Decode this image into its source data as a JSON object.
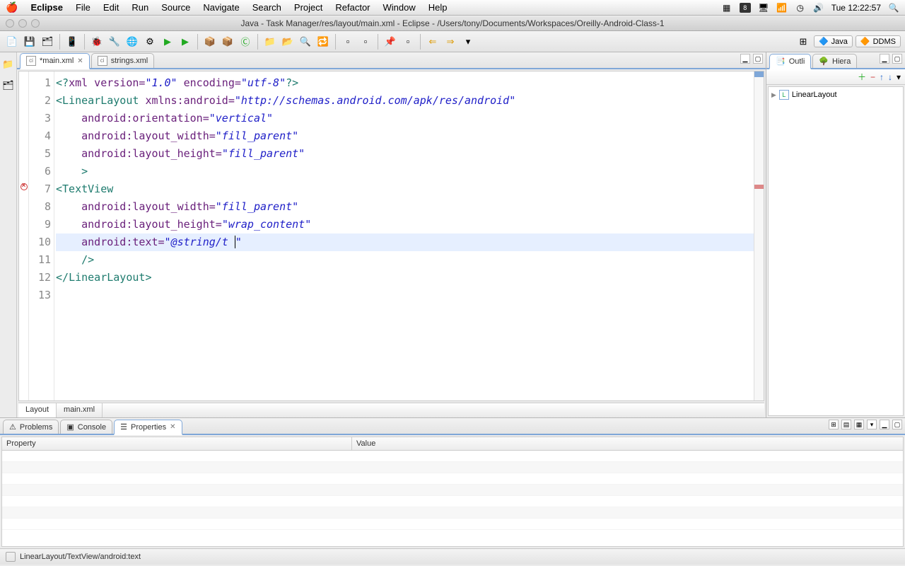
{
  "menubar": {
    "app": "Eclipse",
    "items": [
      "File",
      "Edit",
      "Run",
      "Source",
      "Navigate",
      "Search",
      "Project",
      "Refactor",
      "Window",
      "Help"
    ],
    "clock": "Tue  12:22:57"
  },
  "window": {
    "title": "Java - Task Manager/res/layout/main.xml - Eclipse - /Users/tony/Documents/Workspaces/Oreilly-Android-Class-1"
  },
  "perspectives": {
    "java": "Java",
    "ddms": "DDMS"
  },
  "editor": {
    "tabs": [
      {
        "label": "*main.xml",
        "active": true
      },
      {
        "label": "strings.xml",
        "active": false
      }
    ],
    "bottom_tabs": [
      "Layout",
      "main.xml"
    ],
    "error_line": 7,
    "current_line": 10,
    "lines": [
      {
        "n": 1,
        "segs": [
          {
            "t": "<?",
            "c": "pi"
          },
          {
            "t": "xml version=",
            "c": "attr"
          },
          {
            "t": "\"1.0\"",
            "c": "str"
          },
          {
            "t": " encoding=",
            "c": "attr"
          },
          {
            "t": "\"utf-8\"",
            "c": "str"
          },
          {
            "t": "?>",
            "c": "pi"
          }
        ]
      },
      {
        "n": 2,
        "segs": [
          {
            "t": "<",
            "c": "tag"
          },
          {
            "t": "LinearLayout ",
            "c": "tag"
          },
          {
            "t": "xmlns:android=",
            "c": "attr"
          },
          {
            "t": "\"http://schemas.android.com/apk/res/android\"",
            "c": "str"
          }
        ]
      },
      {
        "n": 3,
        "segs": [
          {
            "t": "    ",
            "c": ""
          },
          {
            "t": "android:orientation=",
            "c": "attr"
          },
          {
            "t": "\"vertical\"",
            "c": "str"
          }
        ]
      },
      {
        "n": 4,
        "segs": [
          {
            "t": "    ",
            "c": ""
          },
          {
            "t": "android:layout_width=",
            "c": "attr"
          },
          {
            "t": "\"fill_parent\"",
            "c": "str"
          }
        ]
      },
      {
        "n": 5,
        "segs": [
          {
            "t": "    ",
            "c": ""
          },
          {
            "t": "android:layout_height=",
            "c": "attr"
          },
          {
            "t": "\"fill_parent\"",
            "c": "str"
          }
        ]
      },
      {
        "n": 6,
        "segs": [
          {
            "t": "    ",
            "c": ""
          },
          {
            "t": ">",
            "c": "tag"
          }
        ]
      },
      {
        "n": 7,
        "segs": [
          {
            "t": "<",
            "c": "tag"
          },
          {
            "t": "TextView",
            "c": "tag"
          }
        ]
      },
      {
        "n": 8,
        "segs": [
          {
            "t": "    ",
            "c": ""
          },
          {
            "t": "android:layout_width=",
            "c": "attr"
          },
          {
            "t": "\"fill_parent\"",
            "c": "str"
          }
        ]
      },
      {
        "n": 9,
        "segs": [
          {
            "t": "    ",
            "c": ""
          },
          {
            "t": "android:layout_height=",
            "c": "attr"
          },
          {
            "t": "\"wrap_content\"",
            "c": "str"
          }
        ]
      },
      {
        "n": 10,
        "segs": [
          {
            "t": "    ",
            "c": ""
          },
          {
            "t": "android:text=",
            "c": "attr"
          },
          {
            "t": "\"",
            "c": "str"
          },
          {
            "t": "@string/t",
            "c": "str"
          },
          {
            "t": "|",
            "c": "cursor"
          },
          {
            "t": "\"",
            "c": "str"
          }
        ]
      },
      {
        "n": 11,
        "segs": [
          {
            "t": "    ",
            "c": ""
          },
          {
            "t": "/>",
            "c": "tag"
          }
        ]
      },
      {
        "n": 12,
        "segs": [
          {
            "t": "</",
            "c": "tag"
          },
          {
            "t": "LinearLayout",
            "c": "tag"
          },
          {
            "t": ">",
            "c": "tag"
          }
        ]
      },
      {
        "n": 13,
        "segs": []
      }
    ]
  },
  "outline": {
    "tabs": [
      {
        "label": "Outli"
      },
      {
        "label": "Hiera"
      }
    ],
    "root": "LinearLayout"
  },
  "bottom": {
    "tabs": [
      {
        "label": "Problems"
      },
      {
        "label": "Console"
      },
      {
        "label": "Properties",
        "active": true
      }
    ],
    "columns": {
      "c1": "Property",
      "c2": "Value"
    }
  },
  "status": "LinearLayout/TextView/android:text"
}
